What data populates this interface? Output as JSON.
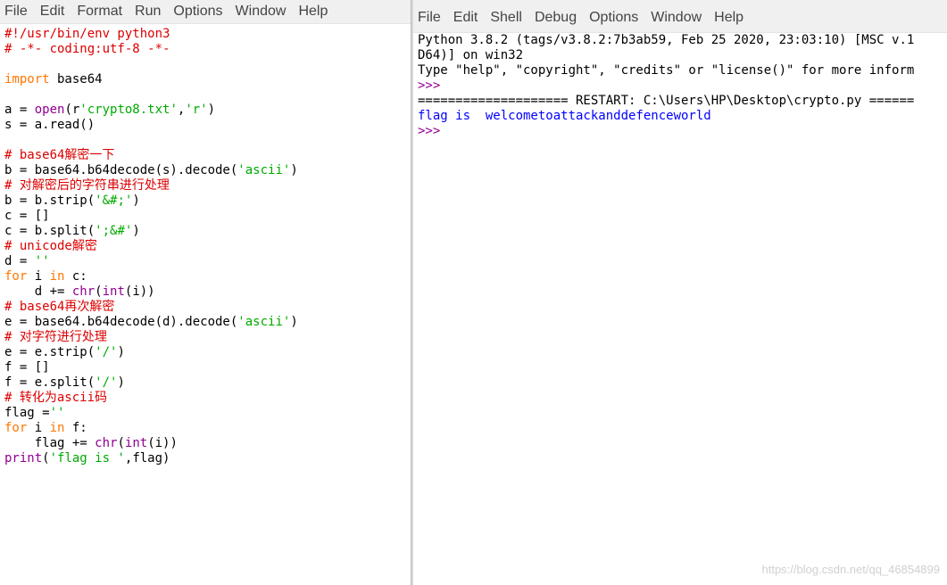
{
  "editor": {
    "menu": [
      "File",
      "Edit",
      "Format",
      "Run",
      "Options",
      "Window",
      "Help"
    ],
    "lines": [
      [
        {
          "t": "#!/usr/bin/env python3",
          "c": "c"
        }
      ],
      [
        {
          "t": "# -*- coding:utf-8 -*-",
          "c": "c"
        }
      ],
      [],
      [
        {
          "t": "import",
          "c": "k"
        },
        {
          "t": " base64",
          "c": "t"
        }
      ],
      [],
      [
        {
          "t": "a = ",
          "c": "t"
        },
        {
          "t": "open",
          "c": "b"
        },
        {
          "t": "(r",
          "c": "t"
        },
        {
          "t": "'crypto8.txt'",
          "c": "s"
        },
        {
          "t": ",",
          "c": "t"
        },
        {
          "t": "'r'",
          "c": "s"
        },
        {
          "t": ")",
          "c": "t"
        }
      ],
      [
        {
          "t": "s = a.read()",
          "c": "t"
        }
      ],
      [],
      [
        {
          "t": "# base64解密一下",
          "c": "c"
        }
      ],
      [
        {
          "t": "b = base64.b64decode(s).decode(",
          "c": "t"
        },
        {
          "t": "'ascii'",
          "c": "s"
        },
        {
          "t": ")",
          "c": "t"
        }
      ],
      [
        {
          "t": "# 对解密后的字符串进行处理",
          "c": "c"
        }
      ],
      [
        {
          "t": "b = b.strip(",
          "c": "t"
        },
        {
          "t": "'&#;'",
          "c": "s"
        },
        {
          "t": ")",
          "c": "t"
        }
      ],
      [
        {
          "t": "c = []",
          "c": "t"
        }
      ],
      [
        {
          "t": "c = b.split(",
          "c": "t"
        },
        {
          "t": "';&#'",
          "c": "s"
        },
        {
          "t": ")",
          "c": "t"
        }
      ],
      [
        {
          "t": "# unicode解密",
          "c": "c"
        }
      ],
      [
        {
          "t": "d = ",
          "c": "t"
        },
        {
          "t": "''",
          "c": "s"
        }
      ],
      [
        {
          "t": "for",
          "c": "k"
        },
        {
          "t": " i ",
          "c": "t"
        },
        {
          "t": "in",
          "c": "k"
        },
        {
          "t": " c:",
          "c": "t"
        }
      ],
      [
        {
          "t": "    d += ",
          "c": "t"
        },
        {
          "t": "chr",
          "c": "b"
        },
        {
          "t": "(",
          "c": "t"
        },
        {
          "t": "int",
          "c": "b"
        },
        {
          "t": "(i))",
          "c": "t"
        }
      ],
      [
        {
          "t": "# base64再次解密",
          "c": "c"
        }
      ],
      [
        {
          "t": "e = base64.b64decode(d).decode(",
          "c": "t"
        },
        {
          "t": "'ascii'",
          "c": "s"
        },
        {
          "t": ")",
          "c": "t"
        }
      ],
      [
        {
          "t": "# 对字符进行处理",
          "c": "c"
        }
      ],
      [
        {
          "t": "e = e.strip(",
          "c": "t"
        },
        {
          "t": "'/'",
          "c": "s"
        },
        {
          "t": ")",
          "c": "t"
        }
      ],
      [
        {
          "t": "f = []",
          "c": "t"
        }
      ],
      [
        {
          "t": "f = e.split(",
          "c": "t"
        },
        {
          "t": "'/'",
          "c": "s"
        },
        {
          "t": ")",
          "c": "t"
        }
      ],
      [
        {
          "t": "# 转化为ascii码",
          "c": "c"
        }
      ],
      [
        {
          "t": "flag =",
          "c": "t"
        },
        {
          "t": "''",
          "c": "s"
        }
      ],
      [
        {
          "t": "for",
          "c": "k"
        },
        {
          "t": " i ",
          "c": "t"
        },
        {
          "t": "in",
          "c": "k"
        },
        {
          "t": " f:",
          "c": "t"
        }
      ],
      [
        {
          "t": "    flag += ",
          "c": "t"
        },
        {
          "t": "chr",
          "c": "b"
        },
        {
          "t": "(",
          "c": "t"
        },
        {
          "t": "int",
          "c": "b"
        },
        {
          "t": "(i))",
          "c": "t"
        }
      ],
      [
        {
          "t": "print",
          "c": "b"
        },
        {
          "t": "(",
          "c": "t"
        },
        {
          "t": "'flag is '",
          "c": "s"
        },
        {
          "t": ",flag)",
          "c": "t"
        }
      ]
    ]
  },
  "shell": {
    "menu": [
      "File",
      "Edit",
      "Shell",
      "Debug",
      "Options",
      "Window",
      "Help"
    ],
    "lines": [
      [
        {
          "t": "Python 3.8.2 (tags/v3.8.2:7b3ab59, Feb 25 2020, 23:03:10) [MSC v.1",
          "c": "t"
        }
      ],
      [
        {
          "t": "D64)] on win32",
          "c": "t"
        }
      ],
      [
        {
          "t": "Type \"help\", \"copyright\", \"credits\" or \"license()\" for more inform",
          "c": "t"
        }
      ],
      [
        {
          "t": ">>>",
          "c": "b"
        }
      ],
      [
        {
          "t": "==================== RESTART: C:\\Users\\HP\\Desktop\\crypto.py ======",
          "c": "t"
        }
      ],
      [
        {
          "t": "flag is  welcometoattackanddefenceworld",
          "c": "o"
        }
      ],
      [
        {
          "t": ">>>",
          "c": "b"
        }
      ]
    ]
  },
  "watermark": "https://blog.csdn.net/qq_46854899"
}
